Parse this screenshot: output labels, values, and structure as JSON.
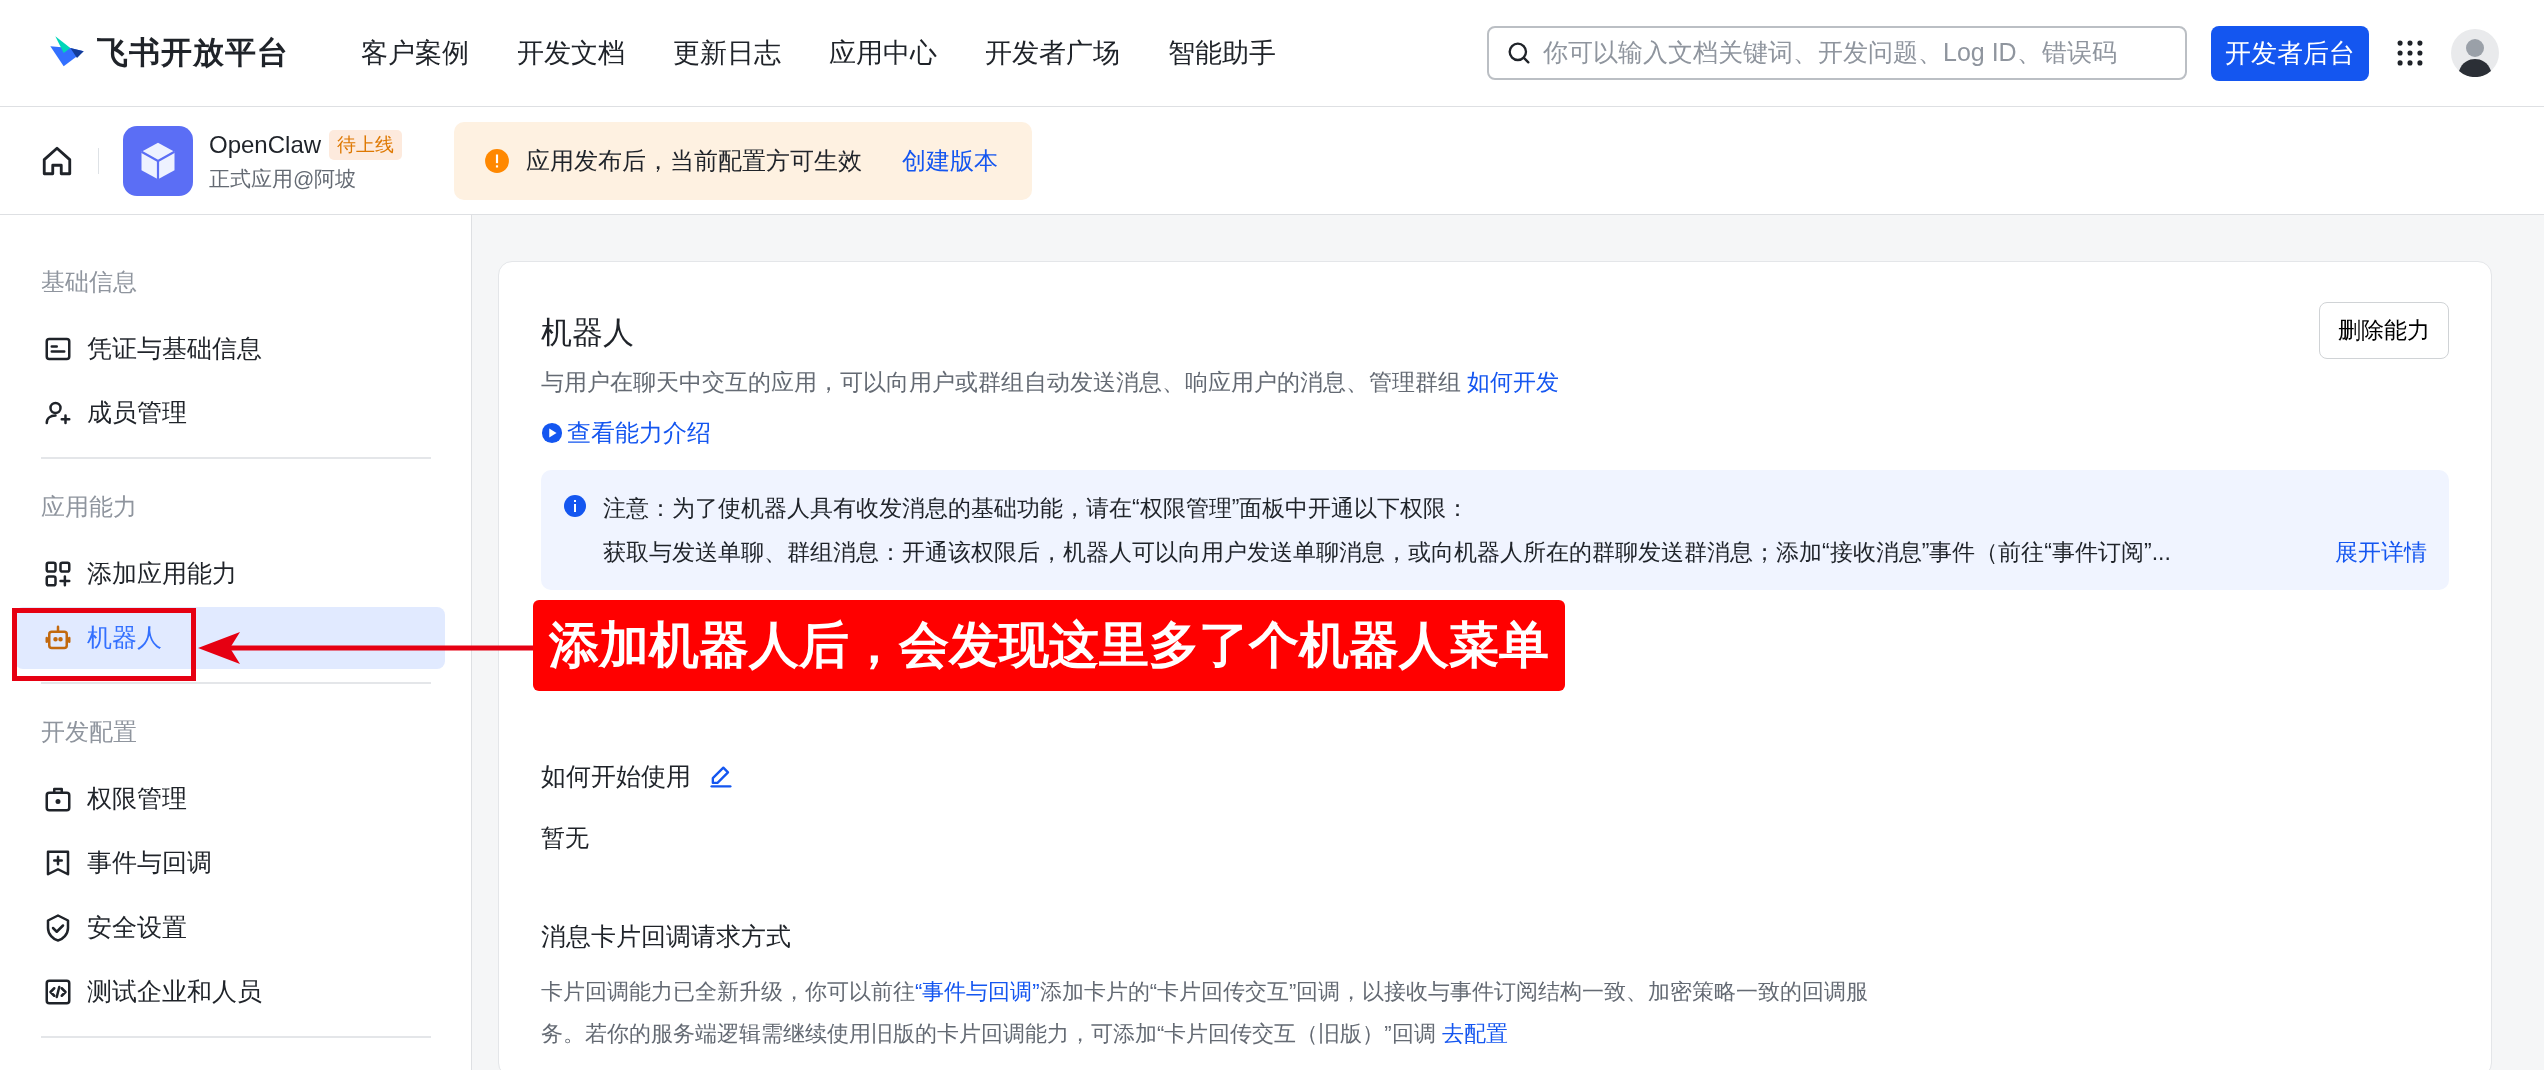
{
  "header": {
    "logo_text": "飞书开放平台",
    "nav": [
      "客户案例",
      "开发文档",
      "更新日志",
      "应用中心",
      "开发者广场",
      "智能助手"
    ],
    "search": {
      "placeholder": "你可以输入文档关键词、开发问题、Log ID、错误码"
    },
    "console_button": "开发者后台"
  },
  "app_bar": {
    "name": "OpenClaw",
    "status": "待上线",
    "subtitle": "正式应用@阿坡",
    "notice": "应用发布后，当前配置方可生效",
    "notice_link": "创建版本"
  },
  "sidebar": {
    "groups": [
      {
        "label": "基础信息",
        "items": [
          {
            "label": "凭证与基础信息",
            "selected": false
          },
          {
            "label": "成员管理",
            "selected": false
          }
        ]
      },
      {
        "label": "应用能力",
        "items": [
          {
            "label": "添加应用能力",
            "selected": false
          },
          {
            "label": "机器人",
            "selected": true
          }
        ]
      },
      {
        "label": "开发配置",
        "items": [
          {
            "label": "权限管理",
            "selected": false
          },
          {
            "label": "事件与回调",
            "selected": false
          },
          {
            "label": "安全设置",
            "selected": false
          },
          {
            "label": "测试企业和人员",
            "selected": false
          }
        ]
      }
    ]
  },
  "main": {
    "title": "机器人",
    "delete_button": "删除能力",
    "description": {
      "text": "与用户在聊天中交互的应用，可以向用户或群组自动发送消息、响应用户的消息、管理群组 ",
      "link": "如何开发"
    },
    "intro_link": "查看能力介绍",
    "info": {
      "line_1": "注意：为了使机器人具有收发消息的基础功能，请在“权限管理”面板中开通以下权限：",
      "line_2": "获取与发送单聊、群组消息：开通该权限后，机器人可以向用户发送单聊消息，或向机器人所在的群聊发送群消息；添加“接收消息”事件（前往“事件订阅”...",
      "expand_link": "展开详情"
    },
    "sections": [
      {
        "kind": "editable",
        "heading": "如何开始使用",
        "body": [
          {
            "kind": "text",
            "text": "暂无"
          }
        ]
      },
      {
        "kind": "note",
        "heading": "消息卡片回调请求方式",
        "body": [
          {
            "kind": "text",
            "text": "卡片回调能力已全新升级，你可以前往"
          },
          {
            "kind": "link",
            "text": "“事件与回调”"
          },
          {
            "kind": "text",
            "text": "添加卡片的“卡片回传交互”回调，以接收与事件订阅结构一致、加密策略一致的回调服务。若你的服务端逻辑需继续使用旧版的卡片回调能力，可添加“卡片回传交互（旧版）”回调 "
          },
          {
            "kind": "link",
            "text": "去配置"
          }
        ]
      }
    ]
  },
  "annotation": {
    "text": "添加机器人后，会发现这里多了个机器人菜单"
  }
}
